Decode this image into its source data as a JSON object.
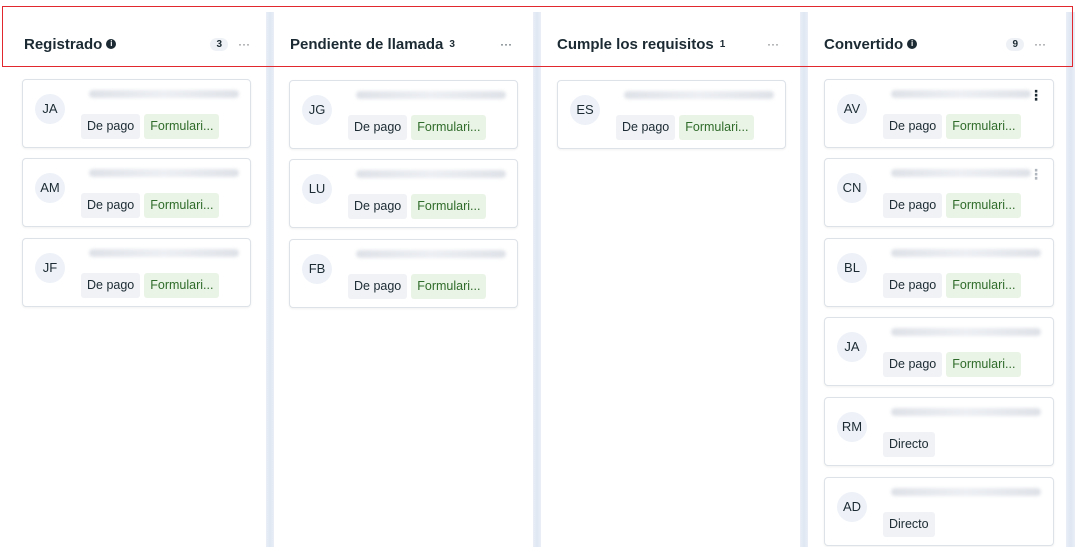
{
  "columns": [
    {
      "title": "Registrado",
      "has_info": true,
      "count": "3",
      "more": "···",
      "cards": [
        {
          "initials": "JA",
          "tags": [
            "De pago",
            "Formulari..."
          ]
        },
        {
          "initials": "AM",
          "tags": [
            "De pago",
            "Formulari..."
          ]
        },
        {
          "initials": "JF",
          "tags": [
            "De pago",
            "Formulari..."
          ]
        }
      ]
    },
    {
      "title": "Pendiente de llamada",
      "has_info": false,
      "count": "3",
      "more": "···",
      "cards": [
        {
          "initials": "JG",
          "tags": [
            "De pago",
            "Formulari..."
          ]
        },
        {
          "initials": "LU",
          "tags": [
            "De pago",
            "Formulari..."
          ]
        },
        {
          "initials": "FB",
          "tags": [
            "De pago",
            "Formulari..."
          ]
        }
      ]
    },
    {
      "title": "Cumple los requisitos",
      "has_info": false,
      "count": "1",
      "more": "···",
      "cards": [
        {
          "initials": "ES",
          "tags": [
            "De pago",
            "Formulari..."
          ]
        }
      ]
    },
    {
      "title": "Convertido",
      "has_info": true,
      "count": "9",
      "more": "···",
      "cards": [
        {
          "initials": "AV",
          "tags": [
            "De pago",
            "Formulari..."
          ],
          "menu": "⋮"
        },
        {
          "initials": "CN",
          "tags": [
            "De pago",
            "Formulari..."
          ],
          "menu": "⋮"
        },
        {
          "initials": "BL",
          "tags": [
            "De pago",
            "Formulari..."
          ]
        },
        {
          "initials": "JA",
          "tags": [
            "De pago",
            "Formulari..."
          ]
        },
        {
          "initials": "RM",
          "tags": [
            "Directo"
          ]
        },
        {
          "initials": "AD",
          "tags": [
            "Directo"
          ]
        }
      ]
    }
  ],
  "info_icon_glyph": "i",
  "colors": {
    "highlight": "#e0282e",
    "tag_green_bg": "#eaf4e6",
    "tag_green_text": "#2f6b2a",
    "tag_gray_bg": "#f0f2f5"
  }
}
